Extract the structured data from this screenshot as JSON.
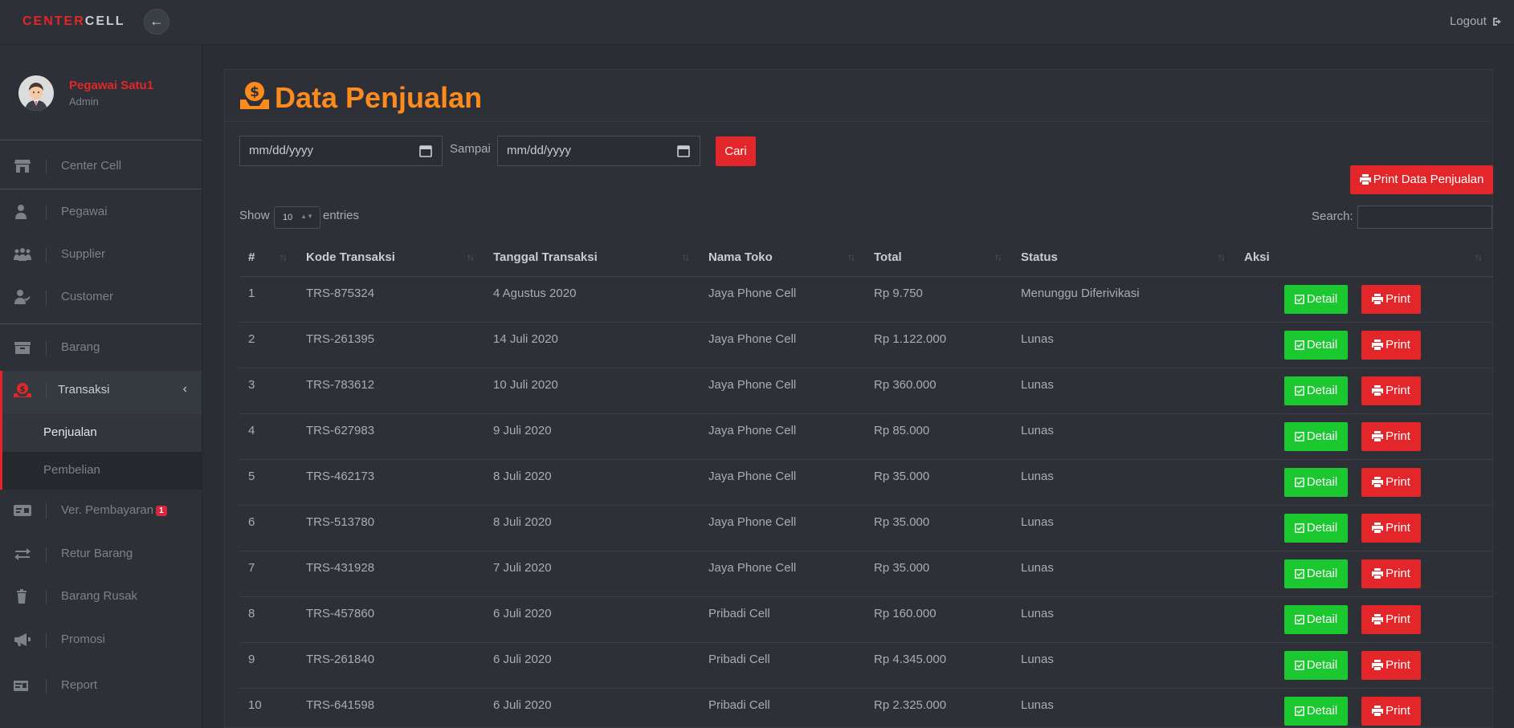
{
  "app": {
    "brand_part1": "CENTER",
    "brand_part2": "CELL",
    "logout_label": "Logout"
  },
  "profile": {
    "name": "Pegawai Satu1",
    "role": "Admin"
  },
  "sidebar": {
    "items": [
      {
        "label": "Center Cell",
        "icon": "store-icon"
      },
      {
        "label": "Pegawai",
        "icon": "user-icon"
      },
      {
        "label": "Supplier",
        "icon": "users-icon"
      },
      {
        "label": "Customer",
        "icon": "user-check-icon"
      },
      {
        "label": "Barang",
        "icon": "archive-icon"
      },
      {
        "label": "Transaksi",
        "icon": "money-icon"
      },
      {
        "label": "Ver. Pembayaran",
        "icon": "card-icon",
        "badge": "1"
      },
      {
        "label": "Retur Barang",
        "icon": "exchange-icon"
      },
      {
        "label": "Barang Rusak",
        "icon": "trash-icon"
      },
      {
        "label": "Promosi",
        "icon": "megaphone-icon"
      },
      {
        "label": "Report",
        "icon": "report-icon"
      }
    ],
    "sub_items": [
      {
        "label": "Penjualan"
      },
      {
        "label": "Pembelian"
      }
    ]
  },
  "page": {
    "title": "Data Penjualan",
    "date_from_placeholder": "mm/dd/yyyy",
    "sampai_label": "Sampai",
    "date_to_placeholder": "mm/dd/yyyy",
    "cari_label": "Cari",
    "print_all_label": "Print Data Penjualan",
    "show_label": "Show",
    "entries_value": "10",
    "entries_label": "entries",
    "search_label": "Search:"
  },
  "table": {
    "headers": [
      "#",
      "Kode Transaksi",
      "Tanggal Transaksi",
      "Nama Toko",
      "Total",
      "Status",
      "Aksi"
    ],
    "detail_label": "Detail",
    "print_label": "Print",
    "rows": [
      {
        "no": "1",
        "kode": "TRS-875324",
        "tanggal": "4 Agustus 2020",
        "toko": "Jaya Phone Cell",
        "total": "Rp 9.750",
        "status": "Menunggu Diferivikasi"
      },
      {
        "no": "2",
        "kode": "TRS-261395",
        "tanggal": "14 Juli 2020",
        "toko": "Jaya Phone Cell",
        "total": "Rp 1.122.000",
        "status": "Lunas"
      },
      {
        "no": "3",
        "kode": "TRS-783612",
        "tanggal": "10 Juli 2020",
        "toko": "Jaya Phone Cell",
        "total": "Rp 360.000",
        "status": "Lunas"
      },
      {
        "no": "4",
        "kode": "TRS-627983",
        "tanggal": "9 Juli 2020",
        "toko": "Jaya Phone Cell",
        "total": "Rp 85.000",
        "status": "Lunas"
      },
      {
        "no": "5",
        "kode": "TRS-462173",
        "tanggal": "8 Juli 2020",
        "toko": "Jaya Phone Cell",
        "total": "Rp 35.000",
        "status": "Lunas"
      },
      {
        "no": "6",
        "kode": "TRS-513780",
        "tanggal": "8 Juli 2020",
        "toko": "Jaya Phone Cell",
        "total": "Rp 35.000",
        "status": "Lunas"
      },
      {
        "no": "7",
        "kode": "TRS-431928",
        "tanggal": "7 Juli 2020",
        "toko": "Jaya Phone Cell",
        "total": "Rp 35.000",
        "status": "Lunas"
      },
      {
        "no": "8",
        "kode": "TRS-457860",
        "tanggal": "6 Juli 2020",
        "toko": "Pribadi Cell",
        "total": "Rp 160.000",
        "status": "Lunas"
      },
      {
        "no": "9",
        "kode": "TRS-261840",
        "tanggal": "6 Juli 2020",
        "toko": "Pribadi Cell",
        "total": "Rp 4.345.000",
        "status": "Lunas"
      },
      {
        "no": "10",
        "kode": "TRS-641598",
        "tanggal": "6 Juli 2020",
        "toko": "Pribadi Cell",
        "total": "Rp 2.325.000",
        "status": "Lunas"
      }
    ]
  },
  "colors": {
    "accent_red": "#e3262a",
    "title_orange": "#ff8a1d",
    "detail_green": "#1bc82f",
    "bg_dark": "#2a2d33"
  }
}
